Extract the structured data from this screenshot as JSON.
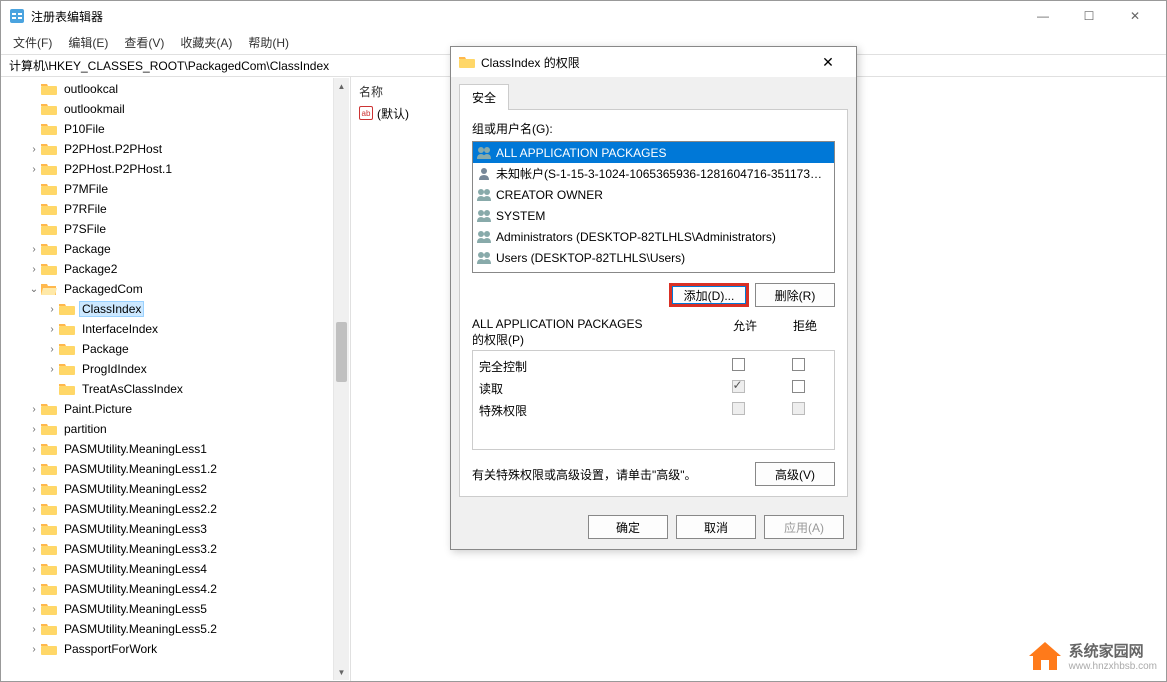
{
  "window": {
    "title": "注册表编辑器",
    "min": "—",
    "max": "☐",
    "close": "✕"
  },
  "menu": {
    "file": "文件(F)",
    "edit": "编辑(E)",
    "view": "查看(V)",
    "favorites": "收藏夹(A)",
    "help": "帮助(H)"
  },
  "address": "计算机\\HKEY_CLASSES_ROOT\\PackagedCom\\ClassIndex",
  "list": {
    "header_name": "名称",
    "default_value": "(默认)"
  },
  "tree": [
    {
      "depth": 1,
      "chev": "",
      "label": "outlookcal"
    },
    {
      "depth": 1,
      "chev": "",
      "label": "outlookmail"
    },
    {
      "depth": 1,
      "chev": "",
      "label": "P10File"
    },
    {
      "depth": 1,
      "chev": ">",
      "label": "P2PHost.P2PHost"
    },
    {
      "depth": 1,
      "chev": ">",
      "label": "P2PHost.P2PHost.1"
    },
    {
      "depth": 1,
      "chev": "",
      "label": "P7MFile"
    },
    {
      "depth": 1,
      "chev": "",
      "label": "P7RFile"
    },
    {
      "depth": 1,
      "chev": "",
      "label": "P7SFile"
    },
    {
      "depth": 1,
      "chev": ">",
      "label": "Package"
    },
    {
      "depth": 1,
      "chev": ">",
      "label": "Package2"
    },
    {
      "depth": 1,
      "chev": "v",
      "label": "PackagedCom",
      "open": true
    },
    {
      "depth": 2,
      "chev": ">",
      "label": "ClassIndex",
      "selected": true
    },
    {
      "depth": 2,
      "chev": ">",
      "label": "InterfaceIndex"
    },
    {
      "depth": 2,
      "chev": ">",
      "label": "Package"
    },
    {
      "depth": 2,
      "chev": ">",
      "label": "ProgIdIndex"
    },
    {
      "depth": 2,
      "chev": "",
      "label": "TreatAsClassIndex"
    },
    {
      "depth": 1,
      "chev": ">",
      "label": "Paint.Picture"
    },
    {
      "depth": 1,
      "chev": ">",
      "label": "partition"
    },
    {
      "depth": 1,
      "chev": ">",
      "label": "PASMUtility.MeaningLess1"
    },
    {
      "depth": 1,
      "chev": ">",
      "label": "PASMUtility.MeaningLess1.2"
    },
    {
      "depth": 1,
      "chev": ">",
      "label": "PASMUtility.MeaningLess2"
    },
    {
      "depth": 1,
      "chev": ">",
      "label": "PASMUtility.MeaningLess2.2"
    },
    {
      "depth": 1,
      "chev": ">",
      "label": "PASMUtility.MeaningLess3"
    },
    {
      "depth": 1,
      "chev": ">",
      "label": "PASMUtility.MeaningLess3.2"
    },
    {
      "depth": 1,
      "chev": ">",
      "label": "PASMUtility.MeaningLess4"
    },
    {
      "depth": 1,
      "chev": ">",
      "label": "PASMUtility.MeaningLess4.2"
    },
    {
      "depth": 1,
      "chev": ">",
      "label": "PASMUtility.MeaningLess5"
    },
    {
      "depth": 1,
      "chev": ">",
      "label": "PASMUtility.MeaningLess5.2"
    },
    {
      "depth": 1,
      "chev": ">",
      "label": "PassportForWork"
    }
  ],
  "dialog": {
    "title": "ClassIndex 的权限",
    "close": "✕",
    "tab_security": "安全",
    "group_label": "组或用户名(G):",
    "users": [
      {
        "icon": "group",
        "label": "ALL APPLICATION PACKAGES",
        "sel": true
      },
      {
        "icon": "user",
        "label": "未知帐户(S-1-15-3-1024-1065365936-1281604716-351173…"
      },
      {
        "icon": "group",
        "label": "CREATOR OWNER"
      },
      {
        "icon": "group",
        "label": "SYSTEM"
      },
      {
        "icon": "group",
        "label": "Administrators (DESKTOP-82TLHLS\\Administrators)"
      },
      {
        "icon": "group",
        "label": "Users (DESKTOP-82TLHLS\\Users)"
      }
    ],
    "add_btn": "添加(D)...",
    "remove_btn": "删除(R)",
    "perm_for_1": "ALL APPLICATION PACKAGES",
    "perm_for_2": "的权限(P)",
    "col_allow": "允许",
    "col_deny": "拒绝",
    "perms": [
      {
        "label": "完全控制",
        "allow": false,
        "deny": false,
        "allow_disabled": false,
        "deny_disabled": false
      },
      {
        "label": "读取",
        "allow": true,
        "deny": false,
        "allow_disabled": true,
        "deny_disabled": false
      },
      {
        "label": "特殊权限",
        "allow": false,
        "deny": false,
        "allow_disabled": true,
        "deny_disabled": true
      }
    ],
    "adv_text": "有关特殊权限或高级设置，请单击\"高级\"。",
    "adv_btn": "高级(V)",
    "ok": "确定",
    "cancel": "取消",
    "apply": "应用(A)"
  },
  "watermark": {
    "line1": "系统家园网",
    "line2": "www.hnzxhbsb.com"
  }
}
